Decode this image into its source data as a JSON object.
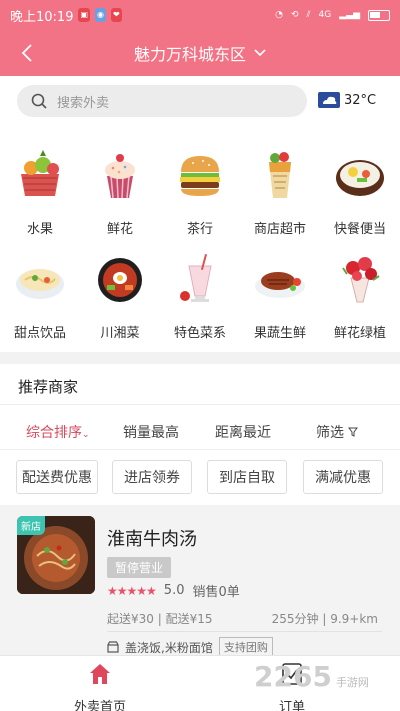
{
  "status_bar": {
    "time": "晚上10:19",
    "signal": "4G",
    "battery": ""
  },
  "header": {
    "title": "魅力万科城东区"
  },
  "search": {
    "placeholder": "搜索外卖"
  },
  "weather": {
    "temp": "32°C"
  },
  "categories": [
    {
      "label": "水果",
      "icon": "fruit-basket-icon"
    },
    {
      "label": "鲜花",
      "icon": "cupcake-icon"
    },
    {
      "label": "茶行",
      "icon": "burger-icon"
    },
    {
      "label": "商店超市",
      "icon": "wrap-icon"
    },
    {
      "label": "快餐便当",
      "icon": "rice-bowl-icon"
    },
    {
      "label": "甜点饮品",
      "icon": "noodle-bowl-icon"
    },
    {
      "label": "川湘菜",
      "icon": "hotpot-icon"
    },
    {
      "label": "特色菜系",
      "icon": "milkshake-icon"
    },
    {
      "label": "果蔬生鲜",
      "icon": "steak-icon"
    },
    {
      "label": "鲜花绿植",
      "icon": "bouquet-icon"
    }
  ],
  "recommend": {
    "title": "推荐商家"
  },
  "sort": {
    "items": [
      "综合排序",
      "销量最高",
      "距离最近",
      "筛选"
    ],
    "active_index": 0
  },
  "chips": [
    "配送费优惠",
    "进店领券",
    "到店自取",
    "满减优惠"
  ],
  "shop": {
    "badge": "新店",
    "name": "淮南牛肉汤",
    "status": "暂停营业",
    "rating": "5.0",
    "rating_value": 5,
    "sales": "销售0单",
    "delivery": "起送¥30 | 配送¥15",
    "time_distance": "255分钟 | 9.9+km",
    "categories": "盖浇饭,米粉面馆",
    "group_tag": "支持团购"
  },
  "bottom_nav": [
    {
      "label": "外卖首页",
      "icon": "home-icon"
    },
    {
      "label": "订单",
      "icon": "order-icon"
    }
  ],
  "watermark": {
    "main": "2265",
    "sub": "手游网"
  },
  "colors": {
    "brand": "#f27386",
    "active": "#d84a5f",
    "new_tag": "#3cc4b0"
  }
}
